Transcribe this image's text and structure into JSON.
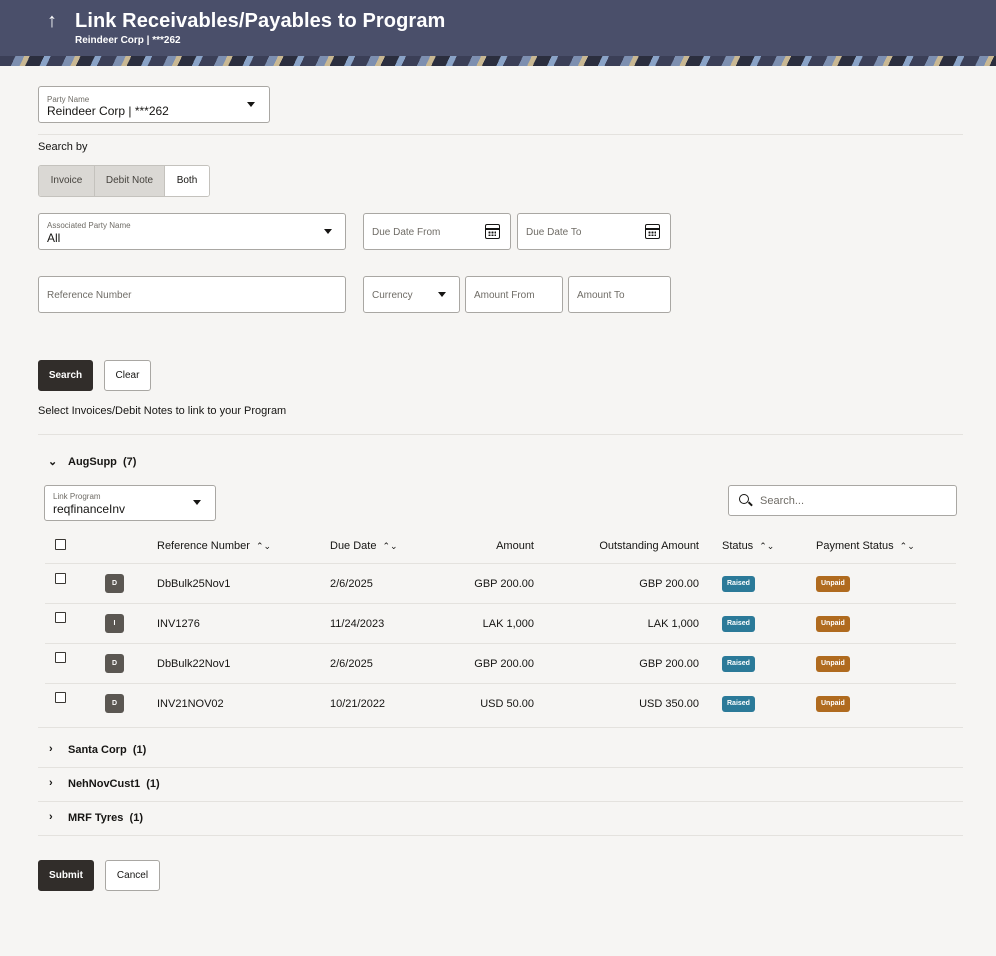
{
  "header": {
    "back_icon": "up-arrow-icon",
    "title": "Link Receivables/Payables to Program",
    "subtitle": "Reindeer Corp | ***262"
  },
  "party": {
    "label": "Party Name",
    "value": "Reindeer Corp | ***262"
  },
  "search_by": {
    "label": "Search by",
    "options": [
      "Invoice",
      "Debit Note",
      "Both"
    ]
  },
  "filters": {
    "associated_party": {
      "label": "Associated Party Name",
      "value": "All"
    },
    "due_date_from": "Due Date From",
    "due_date_to": "Due Date To",
    "reference_number": "Reference Number",
    "currency": "Currency",
    "amount_from": "Amount From",
    "amount_to": "Amount To"
  },
  "actions": {
    "search": "Search",
    "clear": "Clear"
  },
  "instruction": "Select Invoices/Debit Notes to link to your Program",
  "group_expanded": {
    "name": "AugSupp",
    "count": "(7)",
    "link_program": {
      "label": "Link Program",
      "value": "reqfinanceInv"
    },
    "search_placeholder": "Search...",
    "columns": [
      "Reference Number",
      "Due Date",
      "Amount",
      "Outstanding Amount",
      "Status",
      "Payment Status"
    ],
    "rows": [
      {
        "type": "D",
        "ref": "DbBulk25Nov1",
        "due": "2/6/2025",
        "amount": "GBP 200.00",
        "outstanding": "GBP 200.00",
        "status": "Raised",
        "payment": "Unpaid"
      },
      {
        "type": "I",
        "ref": "INV1276",
        "due": "11/24/2023",
        "amount": "LAK 1,000",
        "outstanding": "LAK 1,000",
        "status": "Raised",
        "payment": "Unpaid"
      },
      {
        "type": "D",
        "ref": "DbBulk22Nov1",
        "due": "2/6/2025",
        "amount": "GBP 200.00",
        "outstanding": "GBP 200.00",
        "status": "Raised",
        "payment": "Unpaid"
      },
      {
        "type": "D",
        "ref": "INV21NOV02",
        "due": "10/21/2022",
        "amount": "USD 50.00",
        "outstanding": "USD 350.00",
        "status": "Raised",
        "payment": "Unpaid"
      }
    ]
  },
  "groups_collapsed": [
    {
      "name": "Santa Corp",
      "count": "(1)"
    },
    {
      "name": "NehNovCust1",
      "count": "(1)"
    },
    {
      "name": "MRF Tyres",
      "count": "(1)"
    }
  ],
  "footer": {
    "submit": "Submit",
    "cancel": "Cancel"
  },
  "colors": {
    "header_bg": "#4a4f6a",
    "raised": "#2b7a99",
    "unpaid": "#b06b1f",
    "primary_button": "#312d2a"
  }
}
